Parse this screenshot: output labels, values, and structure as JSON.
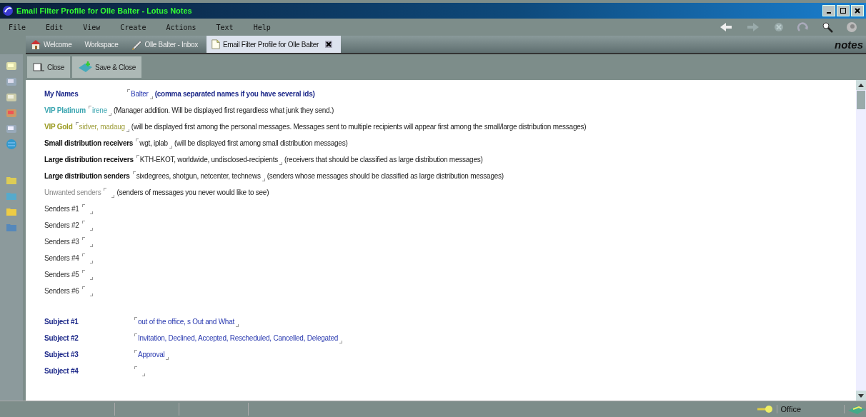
{
  "window": {
    "title": "Email Filter Profile for Olle Balter - Lotus Notes"
  },
  "menu": [
    "File",
    "Edit",
    "View",
    "Create",
    "Actions",
    "Text",
    "Help"
  ],
  "tabs": [
    {
      "label": "Welcome",
      "selected": false
    },
    {
      "label": "Workspace",
      "selected": false
    },
    {
      "label": "Olle Balter - Inbox",
      "selected": false
    },
    {
      "label": "Email Filter Profile for Olle Balter",
      "selected": true
    }
  ],
  "logo": "notes",
  "actions": [
    {
      "label": "Close"
    },
    {
      "label": "Save & Close"
    }
  ],
  "fields": [
    {
      "label": "My Names",
      "kind": "primary",
      "value": "Balter",
      "note": "(comma separated names if you have several ids)"
    },
    {
      "label": "VIP Platinum",
      "kind": "platinum",
      "value": "irene",
      "note": "(Manager addition. Will be displayed first regardless what junk they send.)"
    },
    {
      "label": "VIP Gold",
      "kind": "gold",
      "value": "sidver, madaug",
      "note": "(will be displayed first among the personal messages. Messages sent to multiple recipients will appear first among the small/large distribution messages)"
    },
    {
      "label": "Small distribution receivers",
      "kind": "strong",
      "value": "wgt, iplab",
      "note": "(will be displayed first among small distribution messages)"
    },
    {
      "label": "Large distribution receivers",
      "kind": "strong",
      "value": "KTH-EKOT, worldwide, undisclosed-recipients",
      "note": "(receivers that should be classified as large distribution messages)"
    },
    {
      "label": "Large distribution senders",
      "kind": "strong",
      "value": "sixdegrees, shotgun, netcenter, technews",
      "note": "(senders whose messages should be classified as large distribution messages)"
    },
    {
      "label": "Unwanted senders",
      "kind": "muted",
      "note": "(senders of messages you never would like to see)"
    },
    {
      "label": "Senders #1",
      "kind": "plain"
    },
    {
      "label": "Senders #2",
      "kind": "plain"
    },
    {
      "label": "Senders #3",
      "kind": "plain"
    },
    {
      "label": "Senders #4",
      "kind": "plain"
    },
    {
      "label": "Senders #5",
      "kind": "plain"
    },
    {
      "label": "Senders #6",
      "kind": "plain"
    }
  ],
  "subjects": [
    {
      "label": "Subject #1",
      "value": "out of the office, s Out and What"
    },
    {
      "label": "Subject #2",
      "value": "Invitation, Declined, Accepted, Rescheduled, Cancelled, Delegated"
    },
    {
      "label": "Subject #3",
      "value": "Approval"
    },
    {
      "label": "Subject #4"
    }
  ],
  "status_bar": {
    "location": "Office"
  }
}
